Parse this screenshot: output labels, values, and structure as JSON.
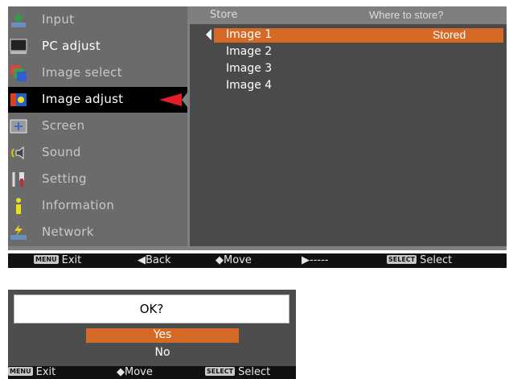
{
  "sidebar": {
    "items": [
      {
        "label": "Input",
        "icon": "input-icon"
      },
      {
        "label": "PC adjust",
        "icon": "pc-adjust-icon"
      },
      {
        "label": "Image select",
        "icon": "image-select-icon"
      },
      {
        "label": "Image adjust",
        "icon": "image-adjust-icon",
        "selected": true
      },
      {
        "label": "Screen",
        "icon": "screen-icon"
      },
      {
        "label": "Sound",
        "icon": "sound-icon"
      },
      {
        "label": "Setting",
        "icon": "setting-icon"
      },
      {
        "label": "Information",
        "icon": "information-icon"
      },
      {
        "label": "Network",
        "icon": "network-icon"
      }
    ]
  },
  "submenu": {
    "title": "Store",
    "header_right": "Where to store?",
    "options": [
      {
        "name": "Image 1",
        "state": "Stored",
        "active": true
      },
      {
        "name": "Image 2",
        "state": ""
      },
      {
        "name": "Image 3",
        "state": ""
      },
      {
        "name": "Image 4",
        "state": ""
      }
    ]
  },
  "status_main": {
    "exit_key": "MENU",
    "exit": "Exit",
    "back": "◀Back",
    "move": "◆Move",
    "next": "▶-----",
    "select_key": "SELECT",
    "select": "Select"
  },
  "dialog": {
    "question": "OK?",
    "yes": "Yes",
    "no": "No"
  },
  "status_dialog": {
    "exit_key": "MENU",
    "exit": "Exit",
    "move": "◆Move",
    "select_key": "SELECT",
    "select": "Select"
  },
  "colors": {
    "accent": "#d46a25",
    "pointer": "#e41f26",
    "panel": "#4a4a4a"
  }
}
